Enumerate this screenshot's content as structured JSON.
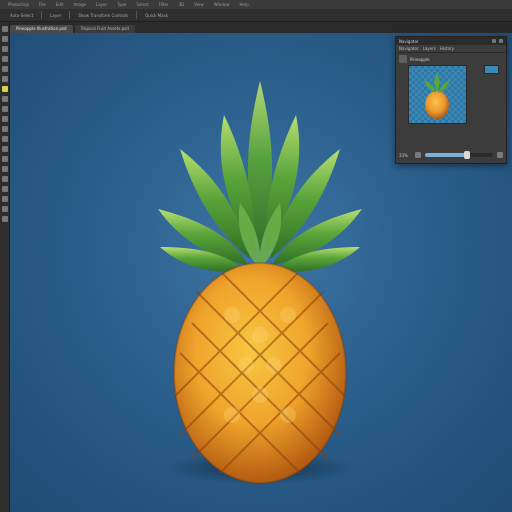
{
  "app": {
    "menu": [
      "Photoshop",
      "File",
      "Edit",
      "Image",
      "Layer",
      "Type",
      "Select",
      "Filter",
      "3D",
      "View",
      "Window",
      "Help"
    ]
  },
  "options_bar": {
    "items": [
      "Auto-Select",
      "Layer",
      "Show Transform Controls",
      "Quick Mask"
    ]
  },
  "tabs": [
    {
      "label": "Pineapple Illustration.psd"
    },
    {
      "label": "Tropical Fruit Assets.psd"
    }
  ],
  "toolbar": {
    "tools": [
      "move-tool",
      "marquee-tool",
      "lasso-tool",
      "quick-select-tool",
      "crop-tool",
      "eyedropper-tool",
      "healing-tool",
      "brush-tool",
      "stamp-tool",
      "history-brush-tool",
      "eraser-tool",
      "gradient-tool",
      "blur-tool",
      "dodge-tool",
      "pen-tool",
      "type-tool",
      "path-select-tool",
      "shape-tool",
      "hand-tool",
      "zoom-tool"
    ]
  },
  "navigator_panel": {
    "title": "Navigator",
    "tabs": [
      "Navigator",
      "Layers",
      "History"
    ],
    "layer_name": "Pineapple",
    "zoom": "33%",
    "slider_level": 0.62
  },
  "colors": {
    "canvas_bg": "#2b5f8c",
    "panel_bg": "#3c3c3c",
    "accent": "#7db0d6"
  }
}
